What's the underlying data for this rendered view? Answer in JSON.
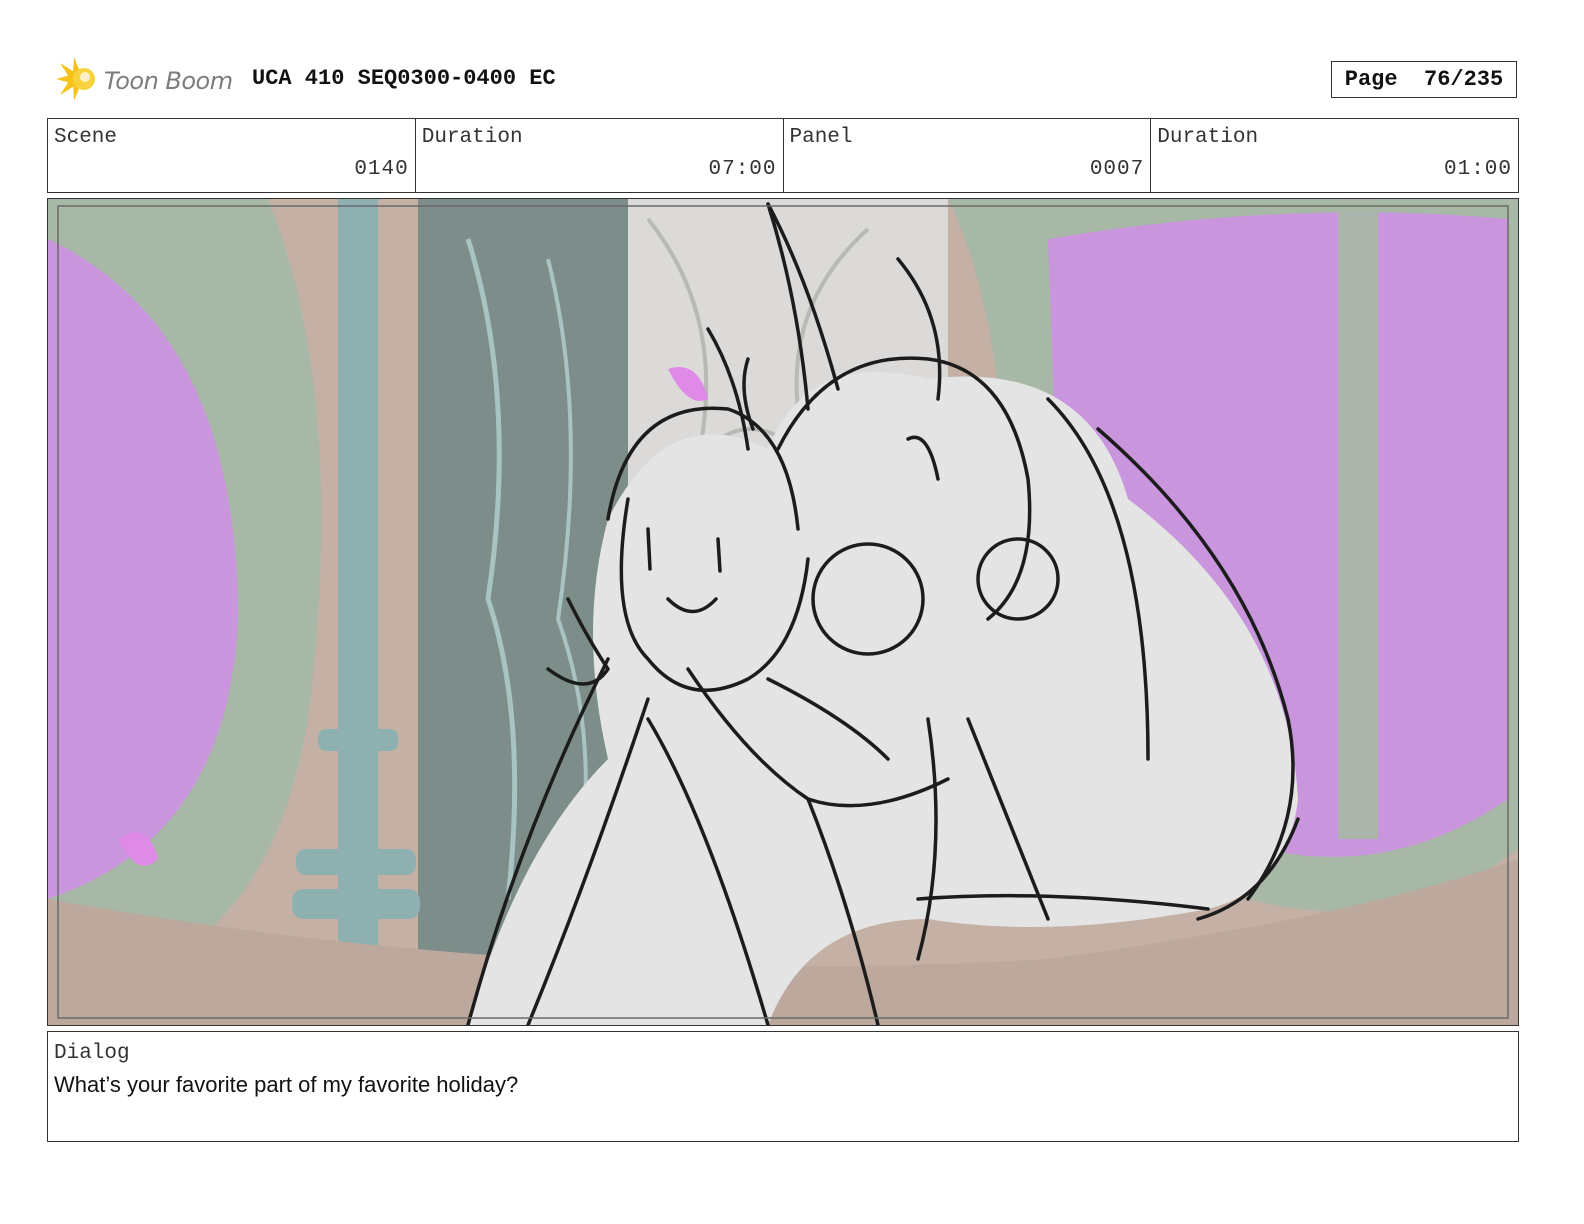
{
  "header": {
    "logo_text": "Toon Boom",
    "title": "UCA 410 SEQ0300-0400 EC",
    "page_label": "Page",
    "page_number": "76/235"
  },
  "info": {
    "scene_label": "Scene",
    "scene_value": "0140",
    "scene_duration_label": "Duration",
    "scene_duration_value": "07:00",
    "panel_label": "Panel",
    "panel_value": "0007",
    "panel_duration_label": "Duration",
    "panel_duration_value": "01:00"
  },
  "dialog": {
    "label": "Dialog",
    "text": "What’s your favorite part of my favorite holiday?"
  },
  "icons": {
    "logo": "starburst-logo-icon"
  },
  "colors": {
    "window_pink": "#c995dd",
    "window_frame": "#a8b8a6",
    "wall": "#c4b0a4",
    "pillar": "#8fb0b0",
    "sketch_fill": "#e4e4e4",
    "logo_yellow": "#f6c21a"
  }
}
